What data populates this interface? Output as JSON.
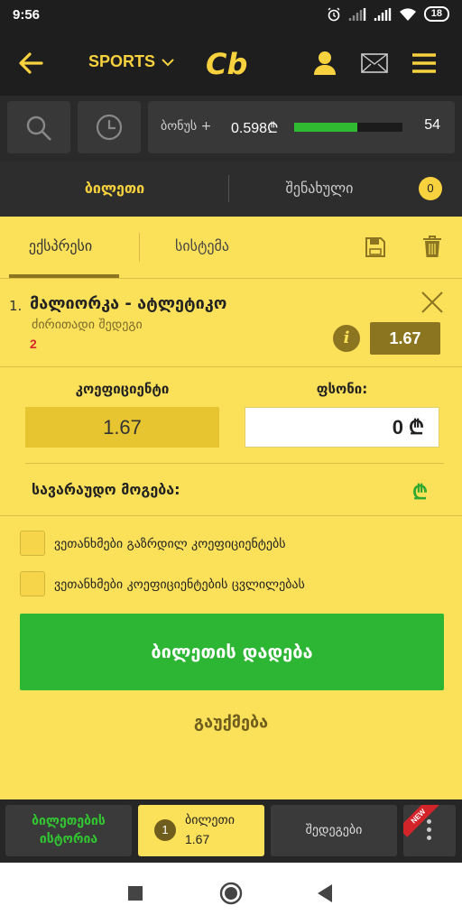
{
  "status_bar": {
    "time": "9:56",
    "battery": "18"
  },
  "header": {
    "sports_label": "SPORTS",
    "logo_text": "Cb"
  },
  "toolbar": {
    "bonus_label": "ბონუს +",
    "bonus_value": "0.598₾",
    "bonus_progress": 0.58,
    "bonus_count": "54"
  },
  "tabs": {
    "ticket": "ბილეთი",
    "saved": "შენახული",
    "saved_count": "0"
  },
  "slip": {
    "subtab_express": "ექსპრესი",
    "subtab_system": "სისტემა",
    "bet": {
      "number": "1.",
      "title": "მალიორკა - ატლეტიკო",
      "market": "ძირითადი შედეგი",
      "pick": "2",
      "odd": "1.67"
    },
    "coef_label": "კოეფიციენტი",
    "stake_label": "ფსონი:",
    "coef_value": "1.67",
    "stake_value": "0 ₾",
    "potential_label": "სავარაუდო მოგება:",
    "potential_currency": "₾",
    "checkbox_increase": "ვეთანხმები გაზრდილ კოეფიციენტებს",
    "checkbox_change": "ვეთანხმები კოეფიციენტების ცვლილებას",
    "place_bet": "ბილეთის დადება",
    "cancel": "გაუქმება"
  },
  "dock": {
    "history_line1": "ბილეთების",
    "history_line2": "ისტორია",
    "ticket_count": "1",
    "ticket_label": "ბილეთი",
    "ticket_odd": "1.67",
    "results": "შედეგები",
    "new_badge": "NEW"
  },
  "colors": {
    "accent": "#f7d23e",
    "slip_bg": "#fbe15a",
    "green": "#2db634",
    "dark": "#1e1e1e"
  }
}
